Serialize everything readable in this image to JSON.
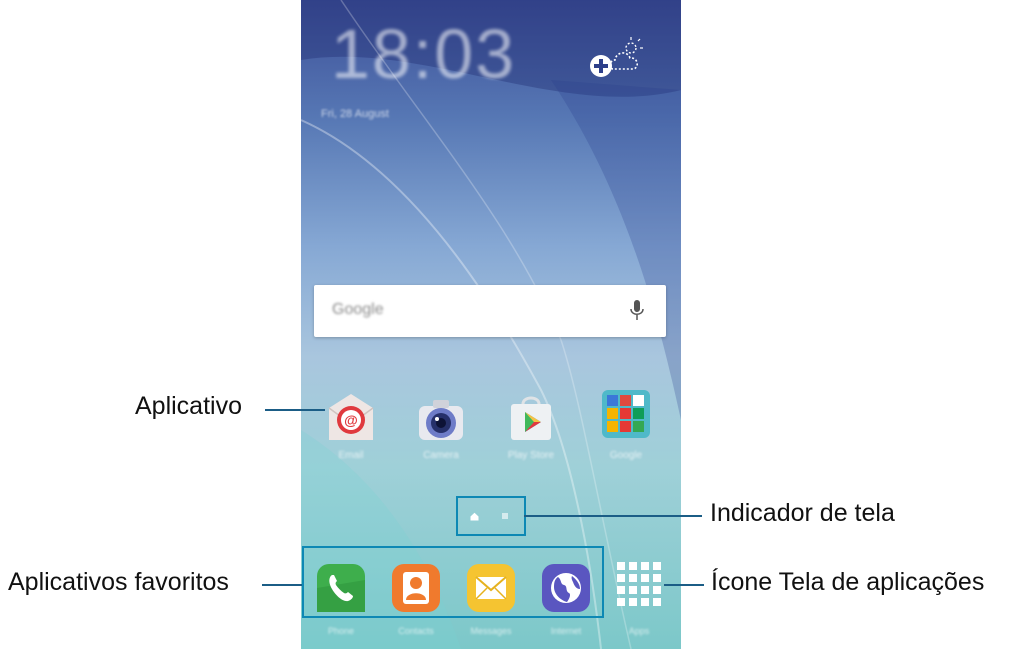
{
  "lock_clock": {
    "time": "18:03",
    "date": "Fri, 28 August"
  },
  "search_bar": {
    "placeholder": "Google"
  },
  "apps": [
    {
      "name": "Email",
      "icon": "email-icon"
    },
    {
      "name": "Camera",
      "icon": "camera-icon"
    },
    {
      "name": "Play Store",
      "icon": "play-store-icon"
    },
    {
      "name": "Google",
      "icon": "google-folder-icon"
    }
  ],
  "dock": [
    {
      "name": "Phone",
      "icon": "phone-icon"
    },
    {
      "name": "Contacts",
      "icon": "contacts-icon"
    },
    {
      "name": "Messages",
      "icon": "messages-icon"
    },
    {
      "name": "Internet",
      "icon": "internet-icon"
    },
    {
      "name": "Apps",
      "icon": "apps-grid-icon"
    }
  ],
  "callouts": {
    "app": "Aplicativo",
    "screen_indicator": "Indicador de tela",
    "favorites": "Aplicativos favoritos",
    "apps_screen_icon": "Ícone Tela de aplicações"
  },
  "colors": {
    "callout_line": "#1b5d86",
    "highlight": "#0d88b4"
  }
}
